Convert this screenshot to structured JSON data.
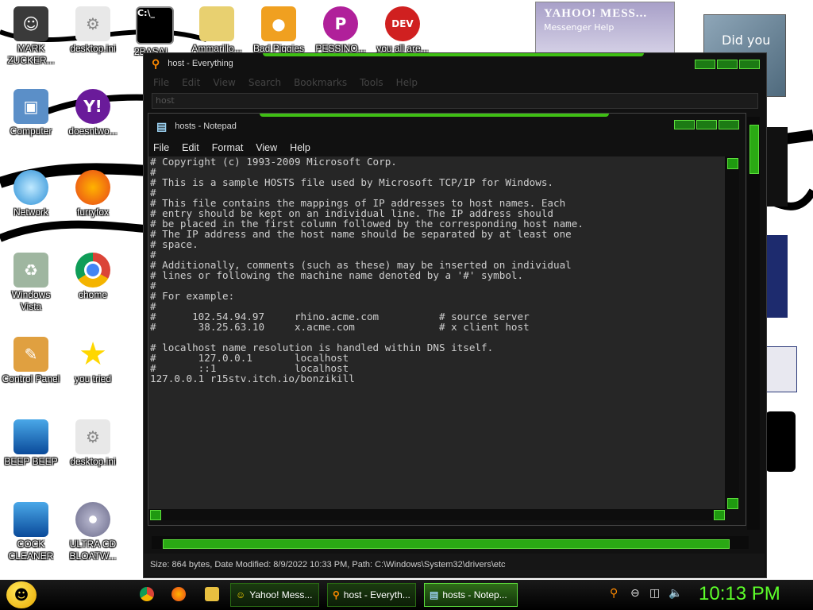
{
  "desktop": {
    "icons": [
      {
        "label": "MARK ZUCKER...",
        "icon": "person-icon"
      },
      {
        "label": "desktop.ini",
        "icon": "settings-file-icon"
      },
      {
        "label": "2BASAI...",
        "icon": "cmd-icon"
      },
      {
        "label": "Ammarillo...",
        "icon": "folder-icon"
      },
      {
        "label": "Bad Piggies",
        "icon": "game-icon"
      },
      {
        "label": "PESSINO...",
        "icon": "paint-icon"
      },
      {
        "label": "you all are...",
        "icon": "devcpp-icon"
      },
      {
        "label": "Computer",
        "icon": "computer-icon"
      },
      {
        "label": "doesntwo...",
        "icon": "yahoo-icon"
      },
      {
        "label": "Network",
        "icon": "network-icon"
      },
      {
        "label": "furryfox",
        "icon": "firefox-icon"
      },
      {
        "label": "Windows Vista",
        "icon": "recycle-bin-icon"
      },
      {
        "label": "chome",
        "icon": "chrome-icon"
      },
      {
        "label": "Control Panel",
        "icon": "control-panel-icon"
      },
      {
        "label": "you tried",
        "icon": "star-icon"
      },
      {
        "label": "BEEP BEEP",
        "icon": "blue-box-icon"
      },
      {
        "label": "desktop.ini",
        "icon": "settings-file-icon"
      },
      {
        "label": "COCK CLEANER",
        "icon": "blue-box-icon"
      },
      {
        "label": "ULTRA CD BLOATW...",
        "icon": "cd-icon"
      }
    ],
    "yahoo_widget": {
      "title": "YAHOO! MESS...",
      "menu": "Messenger   Help"
    },
    "photo_caption": "Did you"
  },
  "everything_window": {
    "title": "host - Everything",
    "menu": [
      "File",
      "Edit",
      "View",
      "Search",
      "Bookmarks",
      "Tools",
      "Help"
    ],
    "search_value": "host",
    "status": "Size: 864 bytes, Date Modified: 8/9/2022 10:33 PM, Path: C:\\Windows\\System32\\drivers\\etc"
  },
  "notepad_window": {
    "title": "hosts - Notepad",
    "menu": [
      "File",
      "Edit",
      "Format",
      "View",
      "Help"
    ],
    "content": "# Copyright (c) 1993-2009 Microsoft Corp.\n#\n# This is a sample HOSTS file used by Microsoft TCP/IP for Windows.\n#\n# This file contains the mappings of IP addresses to host names. Each\n# entry should be kept on an individual line. The IP address should\n# be placed in the first column followed by the corresponding host name.\n# The IP address and the host name should be separated by at least one\n# space.\n#\n# Additionally, comments (such as these) may be inserted on individual\n# lines or following the machine name denoted by a '#' symbol.\n#\n# For example:\n#\n#      102.54.94.97     rhino.acme.com          # source server\n#       38.25.63.10     x.acme.com              # x client host\n\n# localhost name resolution is handled within DNS itself.\n#\t127.0.0.1       localhost\n#\t::1             localhost\n127.0.0.1 r15stv.itch.io/bonzikill"
  },
  "taskbar": {
    "tasks": [
      {
        "label": "Yahoo! Mess...",
        "icon": "yahoo-icon"
      },
      {
        "label": "host - Everyth...",
        "icon": "everything-search-icon"
      },
      {
        "label": "hosts - Notep...",
        "icon": "notepad-icon"
      }
    ],
    "clock": "10:13 PM"
  }
}
